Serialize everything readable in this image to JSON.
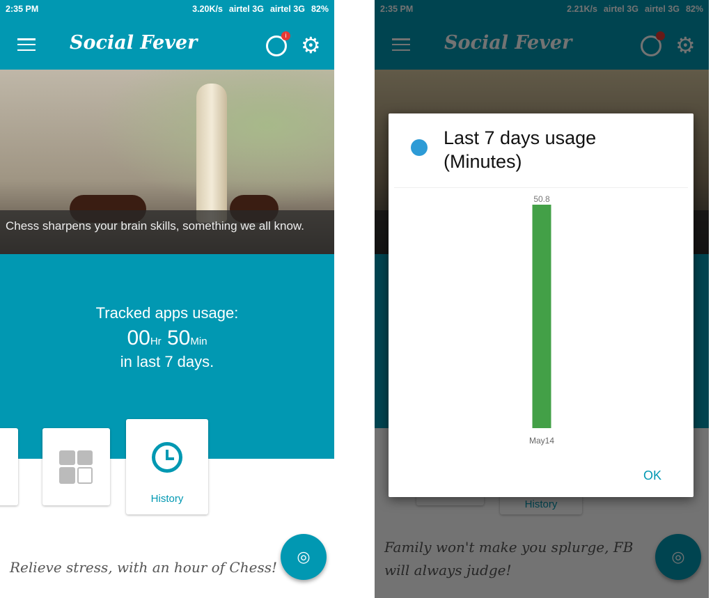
{
  "left": {
    "status": {
      "time": "2:35 PM",
      "speed": "3.20K/s",
      "carrier1": "airtel 3G",
      "carrier2": "airtel 3G",
      "battery": "82%"
    },
    "app_title": "Social Fever",
    "account_badge": "i",
    "hero_caption": "Chess sharpens your brain skills, something we all know.",
    "usage": {
      "label": "Tracked apps usage:",
      "hours": "00",
      "hr_unit": "Hr",
      "minutes": "50",
      "min_unit": "Min",
      "period": "in last 7 days."
    },
    "cards": {
      "history": "History"
    },
    "quote": "Relieve stress, with an hour of Chess!"
  },
  "right": {
    "status": {
      "time": "2:35 PM",
      "speed": "2.21K/s",
      "carrier1": "airtel 3G",
      "carrier2": "airtel 3G",
      "battery": "82%"
    },
    "app_title": "Social Fever",
    "cards": {
      "history": "History"
    },
    "quote": "Family won't make you splurge, FB will always judge!",
    "dialog": {
      "title": "Last 7 days usage (Minutes)",
      "ok": "OK"
    }
  },
  "colors": {
    "primary": "#0198b2",
    "bar": "#43a047",
    "badge": "#e53935"
  },
  "chart_data": {
    "type": "bar",
    "title": "Last 7 days usage (Minutes)",
    "categories": [
      "May14"
    ],
    "values": [
      50.8
    ],
    "value_labels": [
      "50.8"
    ],
    "ylim": [
      0,
      50.8
    ],
    "grid": false
  }
}
